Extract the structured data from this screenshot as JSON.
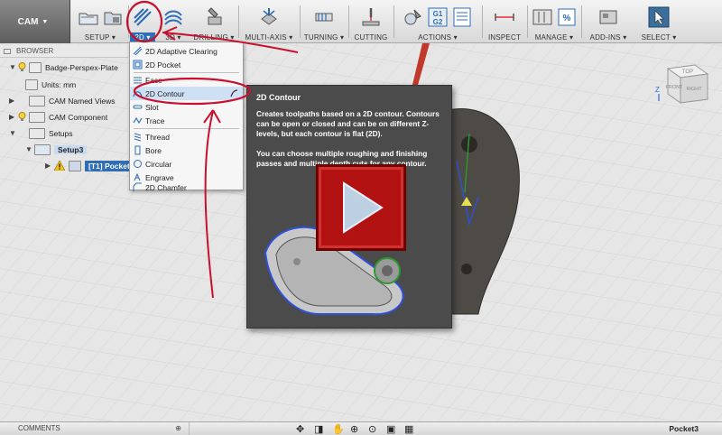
{
  "toolbar": {
    "workspace": "CAM",
    "groups": {
      "setup": "SETUP",
      "twod": "2D",
      "threed": "3D",
      "drilling": "DRILLING",
      "multiaxis": "MULTI-AXIS",
      "turning": "TURNING",
      "cutting": "CUTTING",
      "actions": "ACTIONS",
      "inspect": "INSPECT",
      "manage": "MANAGE",
      "addins": "ADD-INS",
      "select": "SELECT"
    },
    "g1g2_label": "G1\nG2",
    "accent": "#2f6db5"
  },
  "browser": {
    "header": "BROWSER",
    "items": [
      {
        "label": "Badge-Perspex-Plate"
      },
      {
        "label": "Units: mm"
      },
      {
        "label": "CAM Named Views"
      },
      {
        "label": "CAM Component"
      },
      {
        "label": "Setups"
      },
      {
        "label": "Setup3"
      },
      {
        "label": "[T1] Pocket"
      }
    ]
  },
  "dropdown": {
    "items": [
      {
        "label": "2D Adaptive Clearing"
      },
      {
        "label": "2D Pocket"
      },
      {
        "label": "Face"
      },
      {
        "label": "2D Contour"
      },
      {
        "label": "Slot"
      },
      {
        "label": "Trace"
      },
      {
        "label": "Thread"
      },
      {
        "label": "Bore"
      },
      {
        "label": "Circular"
      },
      {
        "label": "Engrave"
      },
      {
        "label": "2D Chamfer"
      }
    ]
  },
  "tooltip": {
    "title": "2D Contour",
    "body": "Creates toolpaths based on a 2D contour. Contours can be open or closed and can be on different Z-levels, but each contour is flat (2D).",
    "body2": "You can choose multiple roughing and finishing passes and multiple depth cuts for any contour."
  },
  "viewcube": {
    "front": "FRONT",
    "right": "RIGHT",
    "top": "TOP",
    "axis_z": "Z"
  },
  "bottom": {
    "comments": "COMMENTS",
    "status": "Pocket3"
  }
}
